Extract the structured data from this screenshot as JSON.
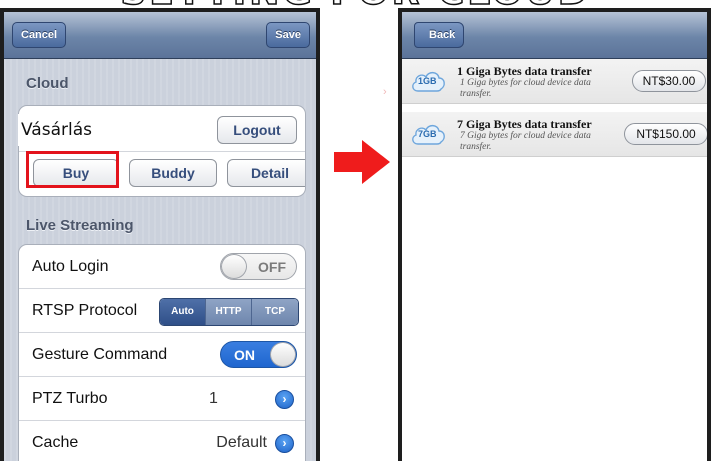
{
  "banner": {
    "text": "SETTING FOR CLOUD"
  },
  "left_screen": {
    "navbar": {
      "cancel_label": "Cancel",
      "save_label": "Save"
    },
    "cloud_section": {
      "header": "Cloud",
      "logout_label": "Logout",
      "buy_label": "Buy",
      "buddy_label": "Buddy",
      "detail_label": "Detail"
    },
    "live_streaming_section": {
      "header": "Live Streaming",
      "auto_login": {
        "label": "Auto Login",
        "toggle": "OFF"
      },
      "rtsp_protocol": {
        "label": "RTSP Protocol",
        "options": [
          "Auto",
          "HTTP",
          "TCP"
        ],
        "selected": "Auto"
      },
      "gesture_command": {
        "label": "Gesture Command",
        "toggle": "ON"
      },
      "ptz_turbo": {
        "label": "PTZ Turbo",
        "value": "1"
      },
      "cache": {
        "label": "Cache",
        "value": "Default"
      }
    }
  },
  "callout": {
    "label": "Vásárlás",
    "color": "#e3131c"
  },
  "right_screen": {
    "navbar": {
      "back_label": "Back"
    },
    "items": [
      {
        "icon_text": "1GB",
        "title": "1 Giga Bytes data transfer",
        "description": "1 Giga bytes for cloud device data transfer.",
        "price": "NT$30.00"
      },
      {
        "icon_text": "7GB",
        "title": "7 Giga Bytes data transfer",
        "description": "7 Giga bytes for cloud device data transfer.",
        "price": "NT$150.00"
      }
    ]
  },
  "colors": {
    "accent_blue": "#1f66cf",
    "nav_blue": "#5b7399",
    "arrow_red": "#ef1c1c"
  }
}
